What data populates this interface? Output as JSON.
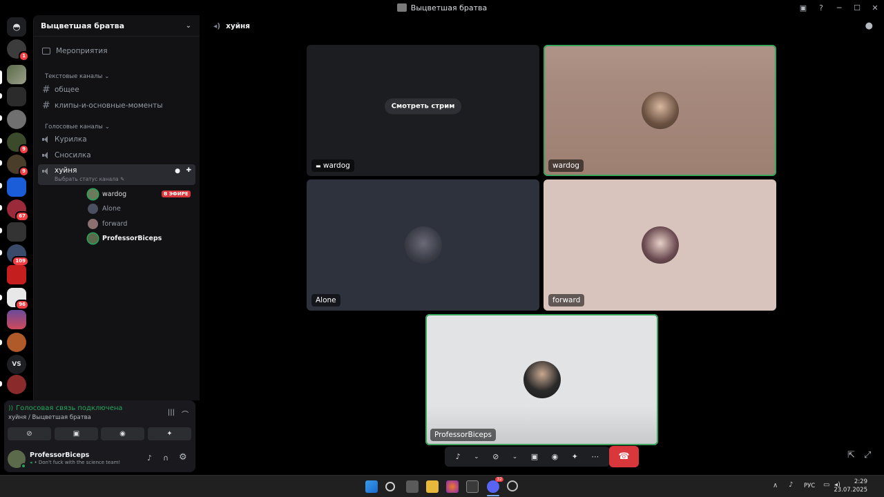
{
  "window": {
    "title": "Выцветшая братва"
  },
  "guild": {
    "name": "Выцветшая братва"
  },
  "sidebar": {
    "events_label": "Мероприятия",
    "text_category": "Текстовые каналы",
    "text_channels": [
      "общее",
      "клипы-и-основные-моменты"
    ],
    "voice_category": "Голосовые каналы",
    "voice_channels": [
      "Курилка",
      "Сносилка",
      "хуйня"
    ],
    "channel_status": "Выбрать статус канала",
    "members": [
      {
        "name": "wardog",
        "live": "В ЭФИРЕ",
        "color": "#dbdee1"
      },
      {
        "name": "Alone",
        "color": "#949ba4"
      },
      {
        "name": "forward",
        "color": "#949ba4"
      },
      {
        "name": "ProfessorBiceps",
        "color": "#f2f3f5"
      }
    ]
  },
  "servers": {
    "badges": [
      "1",
      "9",
      "9",
      "67",
      "109",
      "96"
    ],
    "vs_label": "VS"
  },
  "voice_panel": {
    "status": "Голосовая связь подключена",
    "location": "хуйня / Выцветшая братва"
  },
  "user_panel": {
    "username": "ProfessorBiceps",
    "status": "Don't fuck with the science team!"
  },
  "main": {
    "channel_name": "хуйня",
    "watch_stream": "Смотреть стрим",
    "tiles": [
      {
        "name": "wardog",
        "type": "stream"
      },
      {
        "name": "wardog",
        "type": "avatar"
      },
      {
        "name": "Alone",
        "type": "avatar"
      },
      {
        "name": "forward",
        "type": "avatar"
      },
      {
        "name": "ProfessorBiceps",
        "type": "avatar"
      }
    ]
  },
  "taskbar": {
    "lang": "РУС",
    "time": "2:29",
    "date": "23.07.2025",
    "discord_badge": "32"
  },
  "colors": {
    "accent": "#5865f2",
    "speaking": "#3ba55d",
    "danger": "#da373c",
    "connected": "#23a55a"
  }
}
